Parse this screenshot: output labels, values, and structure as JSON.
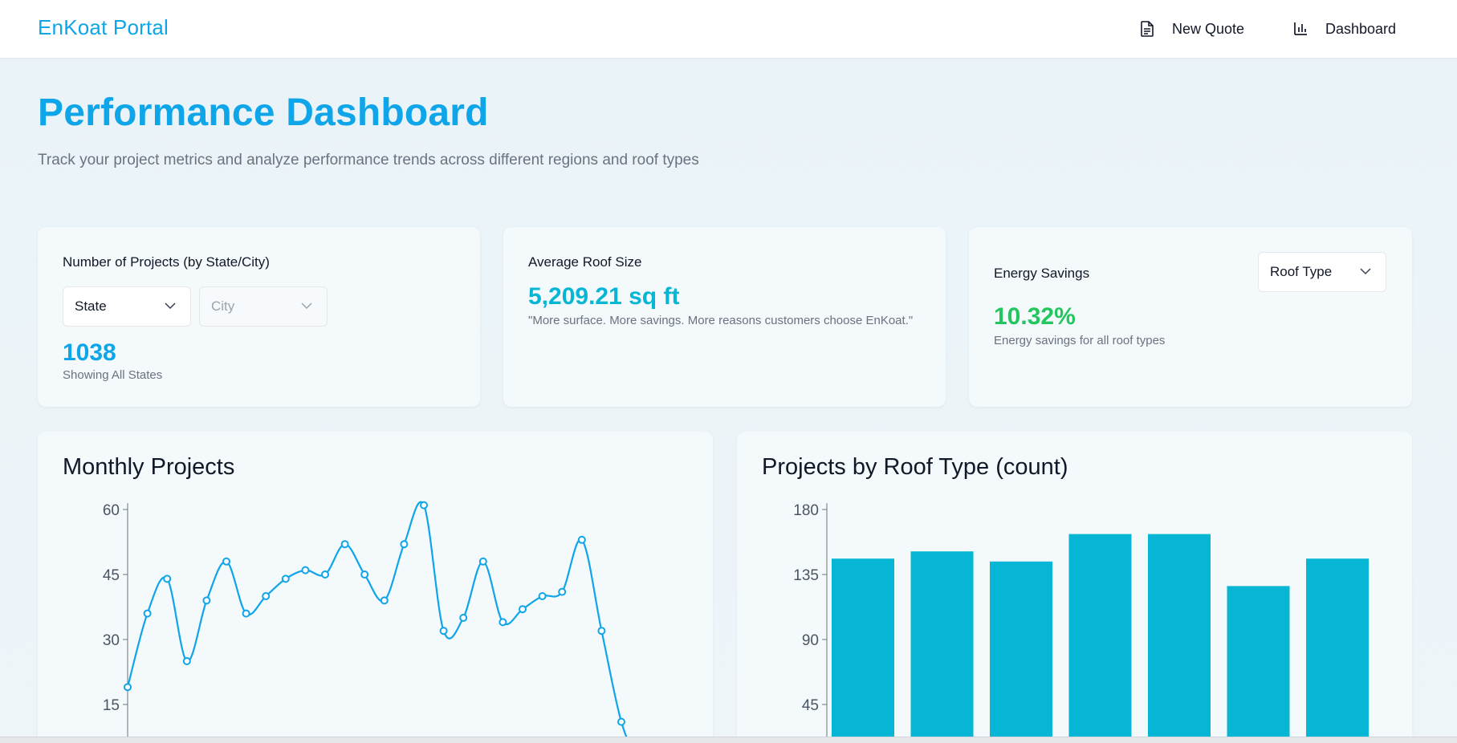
{
  "nav": {
    "brand": "EnKoat Portal",
    "new_quote_label": "New Quote",
    "dashboard_label": "Dashboard",
    "new_quote_icon": "document-icon",
    "dashboard_icon": "bar-chart-icon"
  },
  "header": {
    "title": "Performance Dashboard",
    "subtitle": "Track your project metrics and analyze performance trends across different regions and roof types"
  },
  "cards": {
    "projects": {
      "label": "Number of Projects (by State/City)",
      "state_select": "State",
      "city_select": "City",
      "value": "1038",
      "caption": "Showing All States"
    },
    "roof_size": {
      "label": "Average Roof Size",
      "value": "5,209.21 sq ft",
      "caption": "\"More surface. More savings. More reasons customers choose EnKoat.\""
    },
    "energy": {
      "label": "Energy Savings",
      "roof_type_select": "Roof Type",
      "value": "10.32%",
      "caption": "Energy savings for all roof types"
    }
  },
  "colors": {
    "accent": "#0ea5e9",
    "metric_cyan": "#06b6d4",
    "metric_green": "#22c55e",
    "bar": "#06b6d4",
    "line": "#0ea5e9"
  },
  "chart_data": [
    {
      "type": "line",
      "title": "Monthly Projects",
      "ylim": [
        0,
        60
      ],
      "yticks": [
        15,
        30,
        45,
        60
      ],
      "values": [
        19,
        36,
        44,
        25,
        39,
        48,
        36,
        40,
        44,
        46,
        45,
        52,
        45,
        39,
        52,
        61,
        32,
        35,
        48,
        34,
        37,
        40,
        41,
        53,
        32,
        11,
        0
      ],
      "grid": false
    },
    {
      "type": "bar",
      "title": "Projects by Roof Type (count)",
      "ylim": [
        0,
        180
      ],
      "yticks": [
        45,
        90,
        135,
        180
      ],
      "values": [
        146,
        151,
        144,
        163,
        163,
        127,
        146
      ],
      "grid": false
    }
  ]
}
